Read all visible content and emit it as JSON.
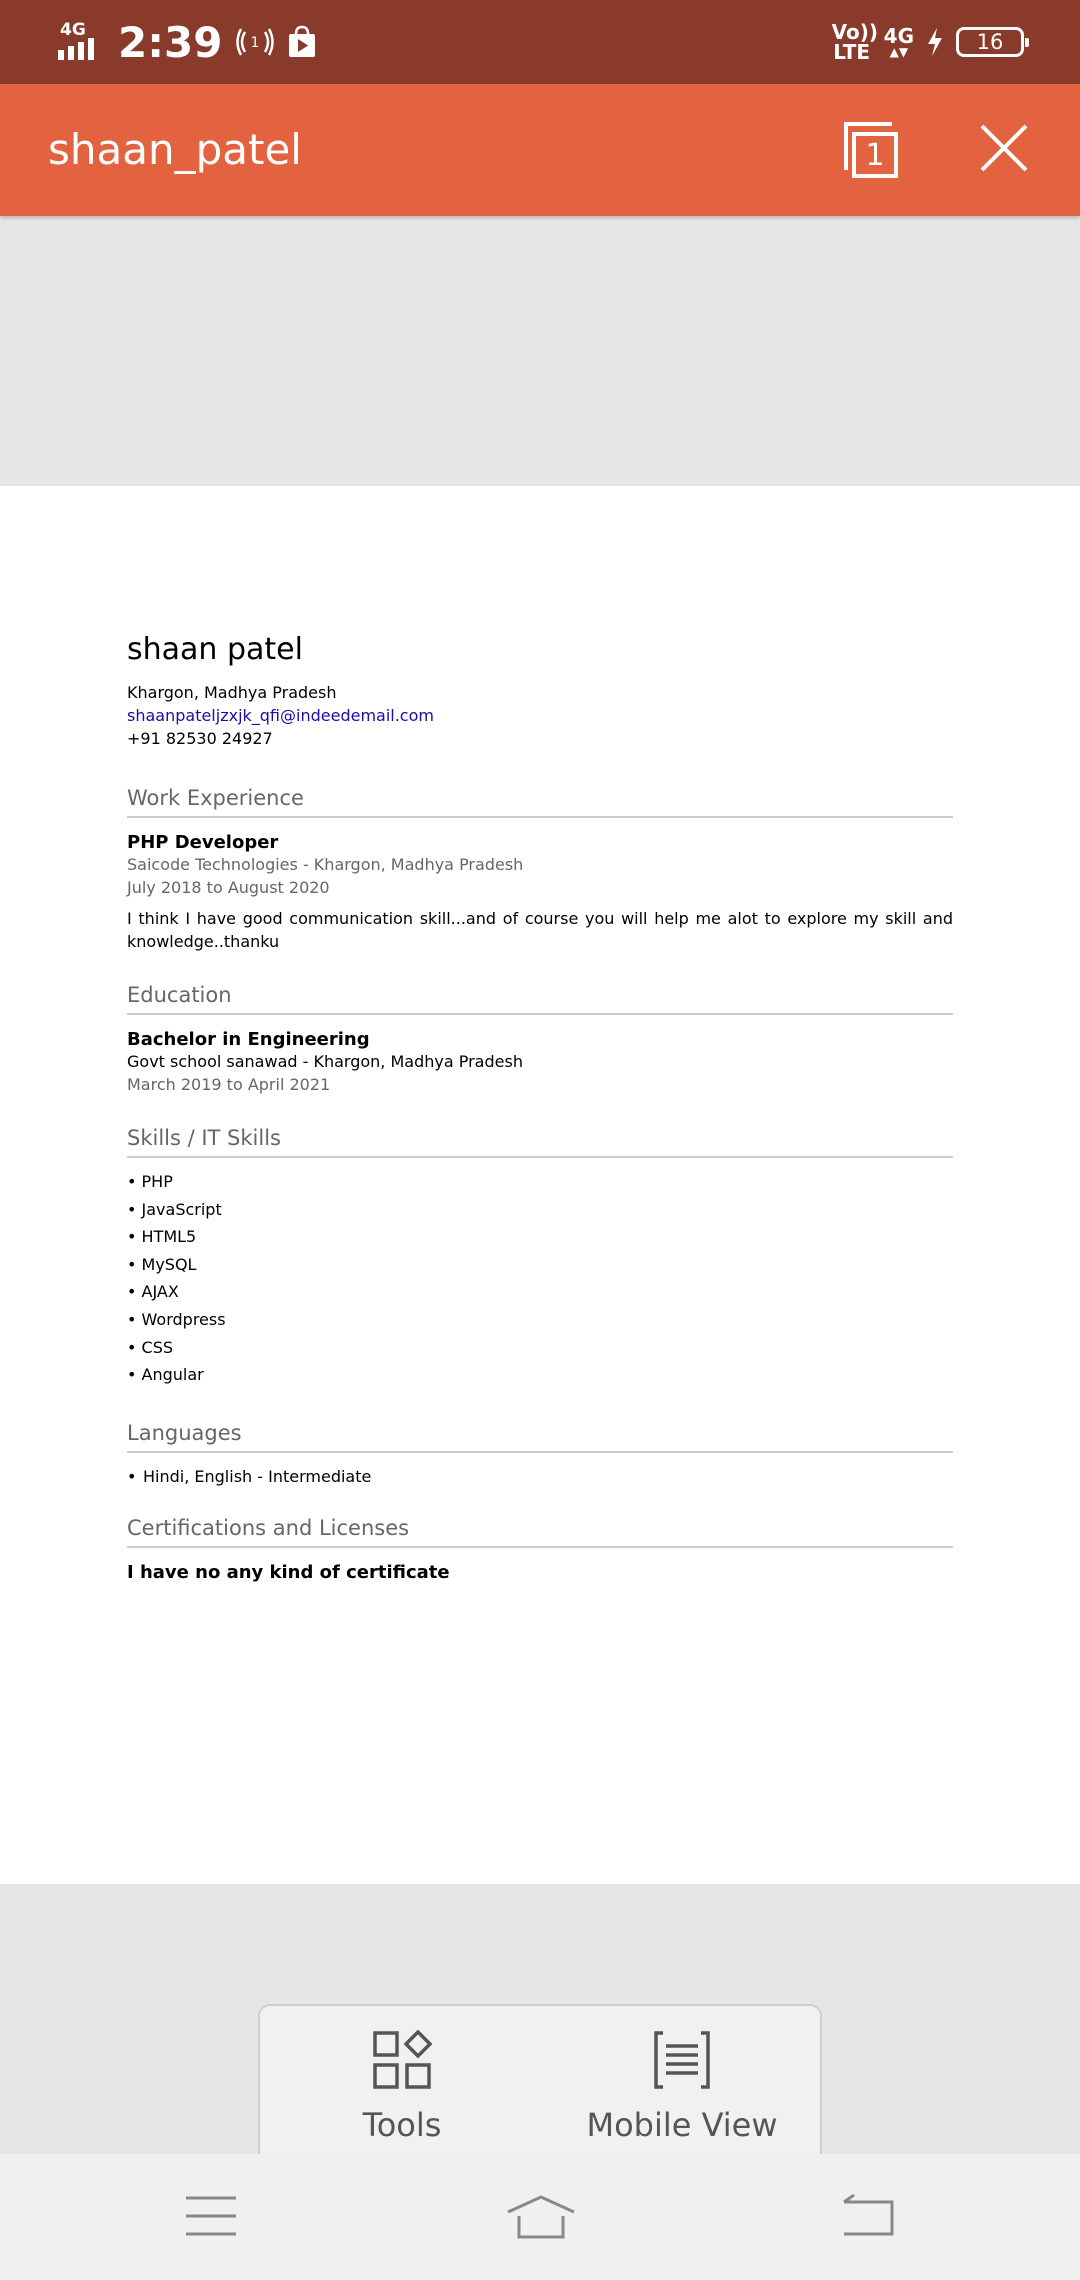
{
  "status_bar": {
    "network": "4G",
    "time": "2:39",
    "volte": "Vo)) LTE",
    "network2": "4G",
    "battery": "16"
  },
  "title_bar": {
    "title": "shaan_patel",
    "page_count": "1"
  },
  "resume": {
    "name": "shaan patel",
    "location": "Khargon, Madhya Pradesh",
    "email": "shaanpateljzxjk_qfi@indeedemail.com",
    "phone": "+91 82530 24927",
    "work": {
      "heading": "Work Experience",
      "title": "PHP Developer",
      "company": "Saicode Technologies - Khargon, Madhya Pradesh",
      "dates": "July 2018 to August 2020",
      "description": "I think I have good communication skill...and of course you will help me alot to explore my skill and knowledge..thanku"
    },
    "education": {
      "heading": "Education",
      "degree": "Bachelor in Engineering",
      "school": "Govt school sanawad - Khargon, Madhya Pradesh",
      "dates": "March 2019 to April 2021"
    },
    "skills": {
      "heading": "Skills / IT Skills",
      "items": [
        "PHP",
        "JavaScript",
        "HTML5",
        "MySQL",
        "AJAX",
        "Wordpress",
        "CSS",
        "Angular"
      ]
    },
    "languages": {
      "heading": "Languages",
      "items": [
        "Hindi, English - Intermediate"
      ]
    },
    "certifications": {
      "heading": "Certifications and Licenses",
      "text": "I have no any kind of certificate"
    }
  },
  "toolbar": {
    "tools_label": "Tools",
    "mobile_view_label": "Mobile View"
  },
  "icons": {
    "pages": "pages-icon",
    "close": "close-icon",
    "tools": "tools-icon",
    "mobile_view": "mobile-view-icon",
    "menu": "menu-icon",
    "home": "home-icon",
    "back": "back-icon"
  },
  "colors": {
    "status_bar": "#8a3a2a",
    "title_bar": "#e36240",
    "link": "#1a0dab"
  }
}
